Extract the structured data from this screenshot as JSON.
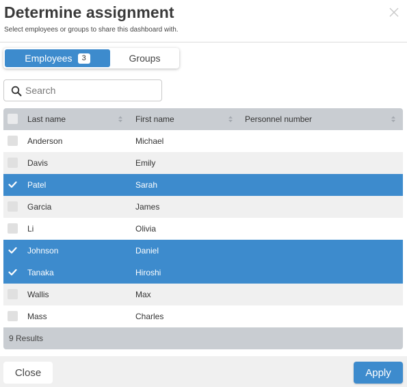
{
  "dialog": {
    "title": "Determine assignment",
    "subtitle": "Select employees or groups to share this dashboard with.",
    "close_icon": "close-x-icon"
  },
  "tabs": {
    "employees_label": "Employees",
    "employees_count": "3",
    "groups_label": "Groups",
    "active": "Employees"
  },
  "search": {
    "placeholder": "Search",
    "value": "",
    "icon": "search-icon"
  },
  "table": {
    "columns": [
      "Last name",
      "First name",
      "Personnel number"
    ],
    "rows": [
      {
        "last": "Anderson",
        "first": "Michael",
        "personnel": "",
        "selected": false
      },
      {
        "last": "Davis",
        "first": "Emily",
        "personnel": "",
        "selected": false
      },
      {
        "last": "Patel",
        "first": "Sarah",
        "personnel": "",
        "selected": true
      },
      {
        "last": "Garcia",
        "first": "James",
        "personnel": "",
        "selected": false
      },
      {
        "last": "Li",
        "first": "Olivia",
        "personnel": "",
        "selected": false
      },
      {
        "last": "Johnson",
        "first": "Daniel",
        "personnel": "",
        "selected": true
      },
      {
        "last": "Tanaka",
        "first": "Hiroshi",
        "personnel": "",
        "selected": true
      },
      {
        "last": "Wallis",
        "first": "Max",
        "personnel": "",
        "selected": false
      },
      {
        "last": "Mass",
        "first": "Charles",
        "personnel": "",
        "selected": false
      }
    ],
    "results_label": "9 Results"
  },
  "footer": {
    "close_label": "Close",
    "apply_label": "Apply"
  },
  "colors": {
    "accent": "#3d8bcd",
    "header_bg": "#c9cdd2",
    "row_alt": "#f0f0f0"
  }
}
